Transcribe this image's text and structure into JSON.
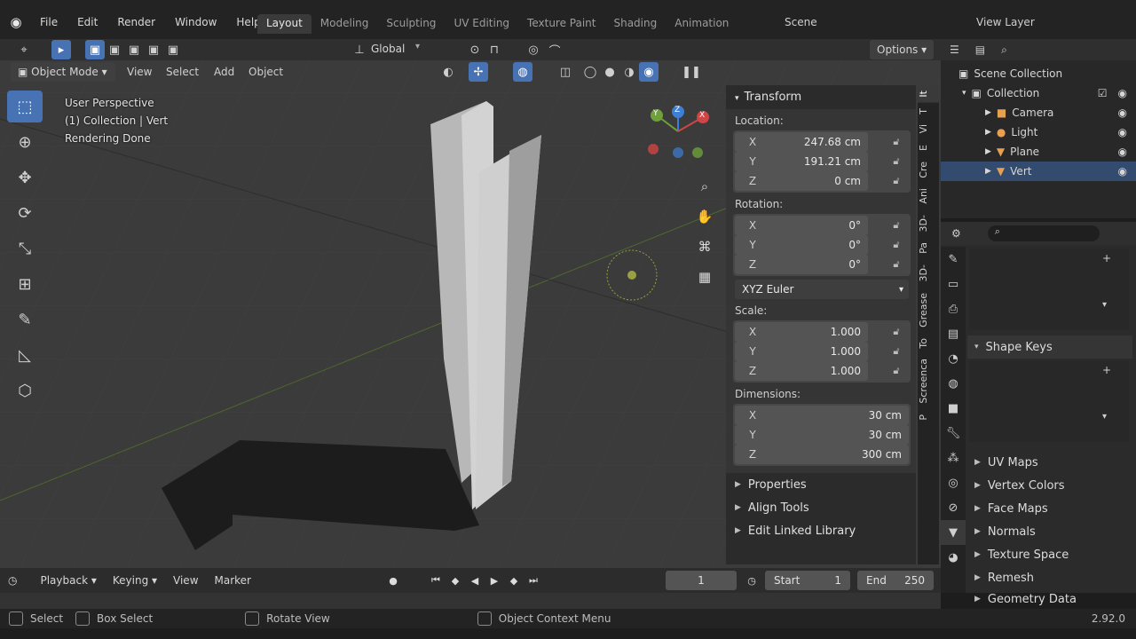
{
  "menubar": {
    "items": [
      "File",
      "Edit",
      "Render",
      "Window",
      "Help"
    ],
    "workspaces": [
      "Layout",
      "Modeling",
      "Sculpting",
      "UV Editing",
      "Texture Paint",
      "Shading",
      "Animation"
    ],
    "active_workspace": "Layout",
    "scene": "Scene",
    "view_layer": "View Layer"
  },
  "header": {
    "transform_orientation": "Global",
    "options_label": "Options",
    "mode": "Object Mode",
    "menus": [
      "View",
      "Select",
      "Add",
      "Object"
    ]
  },
  "viewport": {
    "overlay_lines": [
      "User Perspective",
      "(1) Collection | Vert",
      "Rendering Done"
    ],
    "gizmo": {
      "x": "X",
      "y": "Y",
      "z": "Z"
    }
  },
  "npanel": {
    "title": "Transform",
    "location_label": "Location:",
    "location": [
      {
        "axis": "X",
        "value": "247.68 cm"
      },
      {
        "axis": "Y",
        "value": "191.21 cm"
      },
      {
        "axis": "Z",
        "value": "0 cm"
      }
    ],
    "rotation_label": "Rotation:",
    "rotation": [
      {
        "axis": "X",
        "value": "0°"
      },
      {
        "axis": "Y",
        "value": "0°"
      },
      {
        "axis": "Z",
        "value": "0°"
      }
    ],
    "rotation_mode": "XYZ Euler",
    "scale_label": "Scale:",
    "scale": [
      {
        "axis": "X",
        "value": "1.000"
      },
      {
        "axis": "Y",
        "value": "1.000"
      },
      {
        "axis": "Z",
        "value": "1.000"
      }
    ],
    "dimensions_label": "Dimensions:",
    "dimensions": [
      {
        "axis": "X",
        "value": "30 cm"
      },
      {
        "axis": "Y",
        "value": "30 cm"
      },
      {
        "axis": "Z",
        "value": "300 cm"
      }
    ],
    "sections": [
      "Properties",
      "Align Tools",
      "Edit Linked Library"
    ],
    "tabs": [
      "It",
      "T",
      "Vi",
      "E",
      "Cre",
      "Ani",
      "3D-",
      "Pa",
      "3D-",
      "Grease",
      "To",
      "Screenca",
      "P"
    ]
  },
  "outliner": {
    "root": "Scene Collection",
    "collection": "Collection",
    "objects": [
      "Camera",
      "Light",
      "Plane",
      "Vert"
    ]
  },
  "properties": {
    "search_placeholder": "",
    "shape_keys": "Shape Keys",
    "sections": [
      "UV Maps",
      "Vertex Colors",
      "Face Maps",
      "Normals",
      "Texture Space",
      "Remesh",
      "Geometry Data"
    ]
  },
  "timeline": {
    "menus": [
      "Playback",
      "Keying",
      "View",
      "Marker"
    ],
    "current_frame": "1",
    "start_label": "Start",
    "start": "1",
    "end_label": "End",
    "end": "250"
  },
  "statusbar": {
    "select": "Select",
    "box_select": "Box Select",
    "rotate_view": "Rotate View",
    "context_menu": "Object Context Menu",
    "version": "2.92.0"
  },
  "colors": {
    "accent": "#4772b3",
    "background": "#3a3a3a",
    "panel": "#2b2b2b"
  }
}
